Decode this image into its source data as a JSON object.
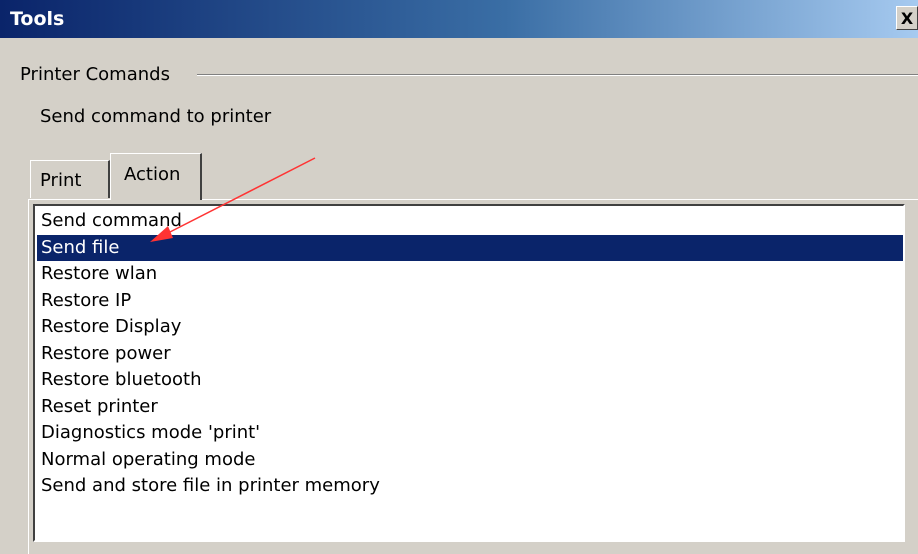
{
  "window": {
    "title": "Tools",
    "close_label": "X"
  },
  "group": {
    "label": "Printer Comands",
    "description": "Send command to printer"
  },
  "tabs": [
    {
      "label": "Print",
      "active": false
    },
    {
      "label": "Action",
      "active": true
    }
  ],
  "list": {
    "selected_index": 1,
    "items": [
      "Send command",
      "Send file",
      "Restore wlan",
      "Restore IP",
      "Restore Display",
      "Restore power",
      "Restore bluetooth",
      "Reset printer",
      "Diagnostics mode 'print'",
      "Normal operating mode",
      "Send and store file in printer memory"
    ]
  },
  "colors": {
    "selection": "#0a246a",
    "annotation_arrow": "#ff3333",
    "dialog_bg": "#d4d0c8"
  }
}
